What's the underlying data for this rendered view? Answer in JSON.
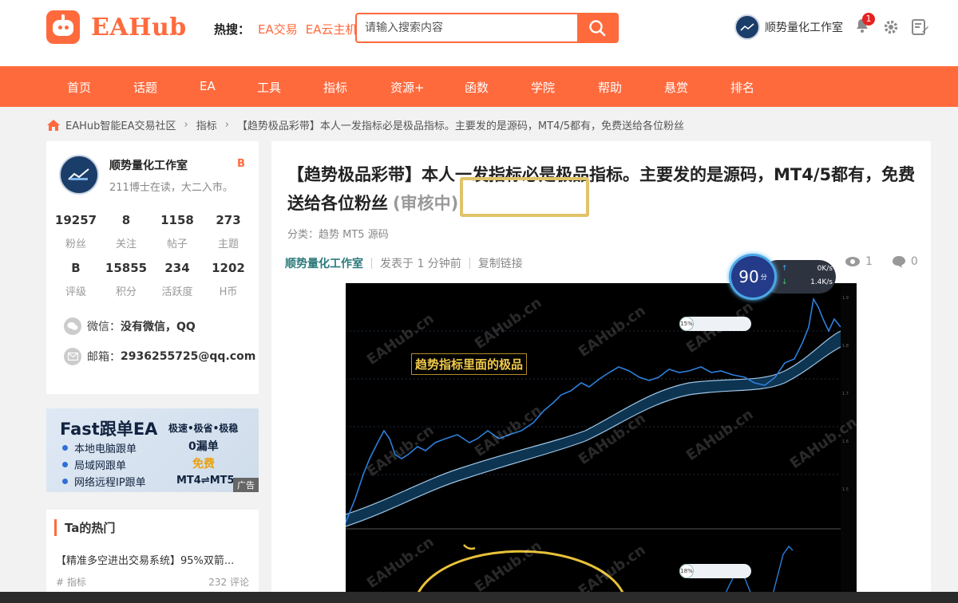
{
  "header": {
    "logo_text": "EAHub",
    "hot_label": "热搜：",
    "hot_links": [
      "EA交易",
      "EA云主机"
    ],
    "search_placeholder": "请输入搜索内容",
    "user_name": "顺势量化工作室",
    "notification_count": "1"
  },
  "nav": [
    "首页",
    "话题",
    "EA",
    "工具",
    "指标",
    "资源+",
    "函数",
    "学院",
    "帮助",
    "悬赏",
    "排名"
  ],
  "breadcrumb": [
    "EAHub智能EA交易社区",
    "指标",
    "【趋势极品彩带】本人一发指标必是极品指标。主要发的是源码，MT4/5都有，免费送给各位粉丝"
  ],
  "profile": {
    "name": "顺势量化工作室",
    "badge": "B",
    "bio": "211博士在读，大二入市。",
    "stats_row1": [
      {
        "value": "19257",
        "label": "粉丝"
      },
      {
        "value": "8",
        "label": "关注"
      },
      {
        "value": "1158",
        "label": "帖子"
      },
      {
        "value": "273",
        "label": "主题"
      }
    ],
    "stats_row2": [
      {
        "value": "B",
        "label": "评级"
      },
      {
        "value": "15855",
        "label": "积分"
      },
      {
        "value": "234",
        "label": "活跃度"
      },
      {
        "value": "1202",
        "label": "H币"
      }
    ],
    "wechat_label": "微信：",
    "wechat_value": "没有微信，QQ",
    "email_label": "邮箱：",
    "email_value": "2936255725@qq.com"
  },
  "ad": {
    "title": "Fast跟单EA",
    "slogan": "极速•极省•极稳",
    "items": [
      "本地电脑跟单",
      "局域网跟单",
      "网络远程IP跟单"
    ],
    "right1": "0漏单",
    "right2": "免费",
    "right3": "MT4⇌MT5",
    "tag": "广告"
  },
  "hot_topics": {
    "heading": "Ta的热门",
    "item_title": "【精准多空进出交易系统】95%双箭...",
    "item_tag": "# 指标",
    "item_comments": "232 评论"
  },
  "post": {
    "title": "【趋势极品彩带】本人一发指标必是极品指标。主要发的是源码，MT4/5都有，免费送给各位粉丝",
    "status": "(审核中)",
    "category": "分类：趋势 MT5 源码",
    "author": "顺势量化工作室",
    "posted": "发表于 1 分钟前",
    "copy_link": "复制链接",
    "views": "1",
    "comments": "0"
  },
  "chart_image": {
    "caption": "趋势指标里面的极品",
    "watermark": "EAHub.cn",
    "pill1": "15%",
    "pill2": "18%"
  },
  "speed_widget": {
    "score": "90",
    "score_unit": "分",
    "up": "0K/s",
    "down": "1.4K/s"
  },
  "colors": {
    "brand": "#ff6a3d",
    "author": "#2c7a7b",
    "highlight_box": "#e0c36a"
  }
}
